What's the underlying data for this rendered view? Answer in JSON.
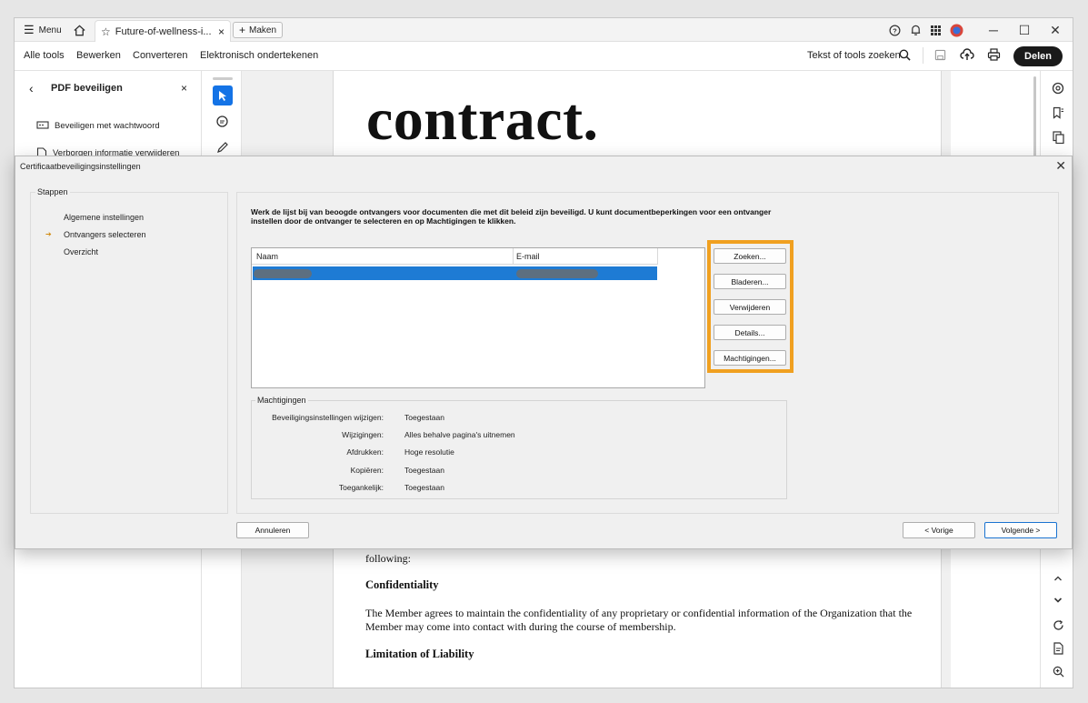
{
  "titlebar": {
    "menu_label": "Menu",
    "tab_title": "Future-of-wellness-i...",
    "new_tab_label": "Maken"
  },
  "menubar": {
    "items": [
      "Alle tools",
      "Bewerken",
      "Converteren",
      "Elektronisch ondertekenen"
    ],
    "search_tools_label": "Tekst of tools zoeken",
    "share_label": "Delen"
  },
  "left_panel": {
    "title": "PDF beveiligen",
    "items": [
      "Beveiligen met wachtwoord",
      "Verborgen informatie verwijderen"
    ]
  },
  "document": {
    "heading": "contract.",
    "para_tail": "following:",
    "section1_title": "Confidentiality",
    "section1_text": "The Member agrees to maintain the confidentiality of any proprietary or confidential information of the Organization that the Member may come into contact with during the course of membership.",
    "section2_title": "Limitation of Liability"
  },
  "dialog": {
    "title": "Certificaatbeveiligingsinstellingen",
    "steps_label": "Stappen",
    "steps": [
      "Algemene instellingen",
      "Ontvangers selecteren",
      "Overzicht"
    ],
    "active_step_marker": "➔",
    "instructions": "Werk de lijst bij van beoogde ontvangers voor documenten die met dit beleid zijn beveiligd. U kunt documentbeperkingen voor een ontvanger instellen door de ontvanger te selecteren en op Machtigingen te klikken.",
    "columns": [
      "Naam",
      "E-mail"
    ],
    "buttons": [
      "Zoeken...",
      "Bladeren...",
      "Verwijderen",
      "Details...",
      "Machtigingen..."
    ],
    "permissions_label": "Machtigingen",
    "permissions": [
      {
        "key": "Beveiligingsinstellingen wijzigen:",
        "value": "Toegestaan"
      },
      {
        "key": "Wijzigingen:",
        "value": "Alles behalve pagina's uitnemen"
      },
      {
        "key": "Afdrukken:",
        "value": "Hoge resolutie"
      },
      {
        "key": "Kopiëren:",
        "value": "Toegestaan"
      },
      {
        "key": "Toegankelijk:",
        "value": "Toegestaan"
      }
    ],
    "cancel_label": "Annuleren",
    "prev_label": "< Vorige",
    "next_label": "Volgende >"
  },
  "colors": {
    "selection": "#1e7bd4",
    "highlight": "#f0a020",
    "share_bg": "#1a1a1a",
    "tool_active": "#1473e6"
  }
}
